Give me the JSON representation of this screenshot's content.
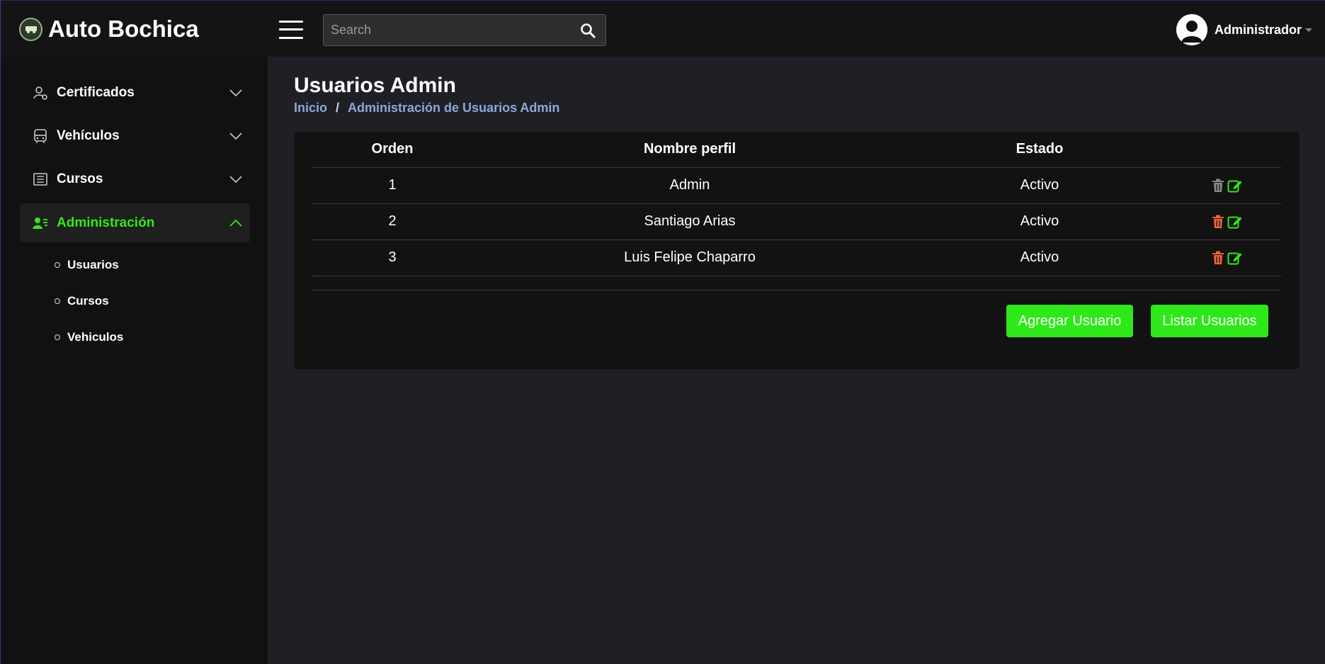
{
  "brand": {
    "title": "Auto Bochica"
  },
  "search": {
    "placeholder": "Search"
  },
  "user": {
    "name": "Administrador"
  },
  "sidebar": {
    "items": [
      {
        "label": "Certificados",
        "icon": "user-gear-icon",
        "expanded": false
      },
      {
        "label": "Vehículos",
        "icon": "bus-icon",
        "expanded": false
      },
      {
        "label": "Cursos",
        "icon": "newspaper-icon",
        "expanded": false
      },
      {
        "label": "Administración",
        "icon": "users-admin-icon",
        "expanded": true
      }
    ],
    "subitems": [
      {
        "label": "Usuarios"
      },
      {
        "label": "Cursos"
      },
      {
        "label": "Vehiculos"
      }
    ]
  },
  "page": {
    "title": "Usuarios Admin",
    "breadcrumb": {
      "home": "Inicio",
      "separator": "/",
      "current": "Administración de Usuarios Admin"
    }
  },
  "table": {
    "headers": [
      "Orden",
      "Nombre perfil",
      "Estado"
    ],
    "rows": [
      {
        "orden": "1",
        "nombre": "Admin",
        "estado": "Activo",
        "delete_enabled": false
      },
      {
        "orden": "2",
        "nombre": "Santiago Arias",
        "estado": "Activo",
        "delete_enabled": true
      },
      {
        "orden": "3",
        "nombre": "Luis Felipe Chaparro",
        "estado": "Activo",
        "delete_enabled": true
      }
    ]
  },
  "buttons": {
    "add": "Agregar Usuario",
    "list": "Listar Usuarios"
  },
  "colors": {
    "accent": "#2ee81a",
    "delete_active": "#f0643a",
    "delete_disabled": "#8a8a8a",
    "edit": "#2ee81a",
    "breadcrumb": "#8ea6d6"
  }
}
